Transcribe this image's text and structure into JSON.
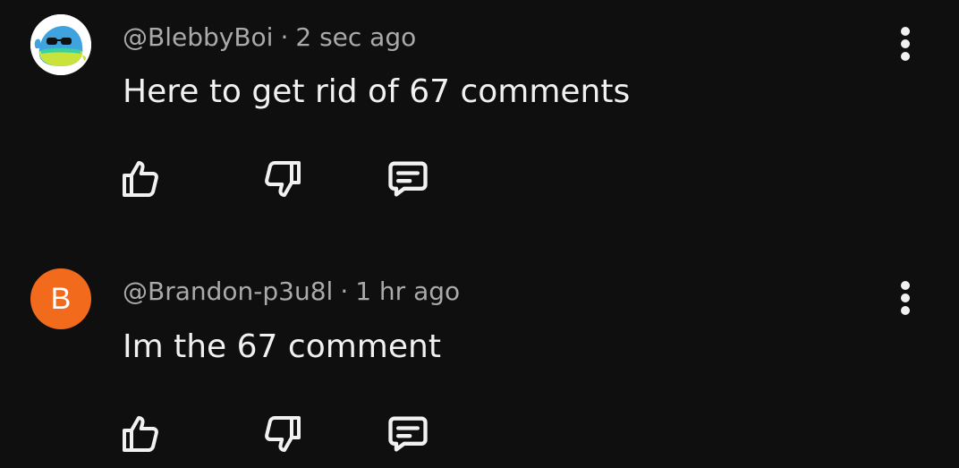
{
  "comments": [
    {
      "username": "@BlebbyBoi",
      "separator": "·",
      "time": "2 sec ago",
      "text": "Here to get rid of 67 comments",
      "avatar": {
        "type": "image",
        "icon": "blob-with-sunglasses-avatar"
      }
    },
    {
      "username": "@Brandon-p3u8l",
      "separator": "·",
      "time": "1 hr ago",
      "text": "Im the 67 comment",
      "avatar": {
        "type": "letter",
        "letter": "B",
        "color": "#f26a1b"
      }
    }
  ],
  "icons": {
    "like": "thumbs-up-icon",
    "dislike": "thumbs-down-icon",
    "reply": "reply-icon",
    "more": "more-vertical-icon"
  },
  "colors": {
    "background": "#0f0f0f",
    "text_primary": "#f1f1f1",
    "text_secondary": "#aaaaaa"
  }
}
